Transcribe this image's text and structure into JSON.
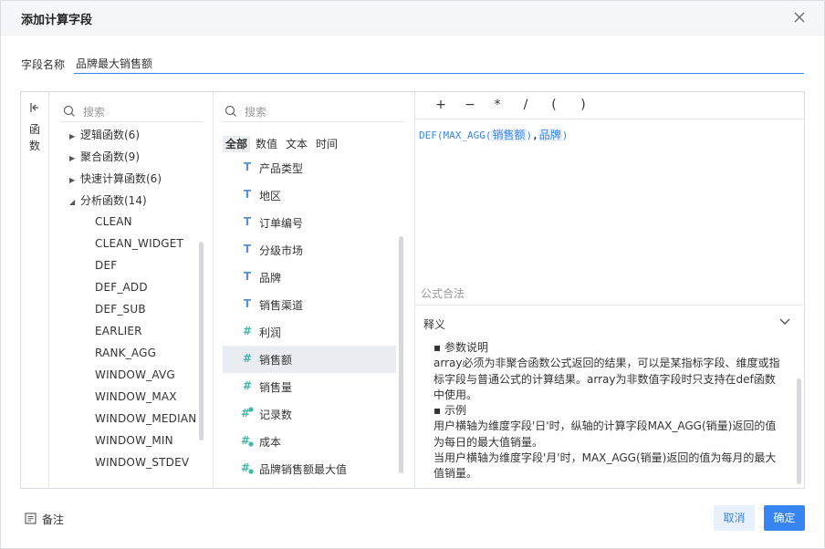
{
  "dialog": {
    "title": "添加计算字段",
    "field_name_label": "字段名称",
    "field_name_value": "品牌最大销售额"
  },
  "side_tab": {
    "label": "函数"
  },
  "functions": {
    "search_placeholder": "搜索",
    "groups": [
      {
        "label": "逻辑函数(6)",
        "expanded": false
      },
      {
        "label": "聚合函数(9)",
        "expanded": false
      },
      {
        "label": "快速计算函数(6)",
        "expanded": false
      },
      {
        "label": "分析函数(14)",
        "expanded": true
      }
    ],
    "items": [
      "CLEAN",
      "CLEAN_WIDGET",
      "DEF",
      "DEF_ADD",
      "DEF_SUB",
      "EARLIER",
      "RANK_AGG",
      "WINDOW_AVG",
      "WINDOW_MAX",
      "WINDOW_MEDIAN",
      "WINDOW_MIN",
      "WINDOW_STDEV"
    ]
  },
  "fields": {
    "search_placeholder": "搜索",
    "tabs": [
      "全部",
      "数值",
      "文本",
      "时间"
    ],
    "active_tab": "全部",
    "items": [
      {
        "name": "产品类型",
        "type": "text-icon"
      },
      {
        "name": "地区",
        "type": "text-icon"
      },
      {
        "name": "订单编号",
        "type": "text-icon"
      },
      {
        "name": "分级市场",
        "type": "text-icon"
      },
      {
        "name": "品牌",
        "type": "text-icon"
      },
      {
        "name": "销售渠道",
        "type": "text-icon"
      },
      {
        "name": "利润",
        "type": "number-icon"
      },
      {
        "name": "销售额",
        "type": "number-icon",
        "selected": true
      },
      {
        "name": "销售量",
        "type": "number-icon"
      },
      {
        "name": "记录数",
        "type": "calculated-number-icon"
      },
      {
        "name": "成本",
        "type": "calculated-number-icon"
      },
      {
        "name": "品牌销售额最大值",
        "type": "calculated-number-icon"
      }
    ]
  },
  "editor": {
    "operators": [
      "+",
      "−",
      "*",
      "/",
      "(",
      ")"
    ],
    "formula": {
      "prefix": "DEF(MAX_AGG(",
      "token1": "销售额",
      "middle": ")",
      "comma": ",",
      "token2": "品牌",
      "suffix": ")"
    },
    "status": "公式合法"
  },
  "description": {
    "title": "释义",
    "lines": [
      "▪ 参数说明",
      "array必须为非聚合函数公式返回的结果，可以是某指标字段、维度或指",
      "标字段与普通公式的计算结果。array为非数值字段时只支持在def函数",
      "中使用。",
      "▪ 示例",
      "用户横轴为维度字段'日'时，纵轴的计算字段MAX_AGG(销量)返回的值",
      "为每日的最大值销量。",
      "当用户横轴为维度字段'月'时，MAX_AGG(销量)返回的值为每月的最大",
      "值销量。"
    ]
  },
  "footer": {
    "note_label": "备注",
    "cancel_label": "取消",
    "ok_label": "确定"
  },
  "colors": {
    "accent": "#3685f2",
    "header_bg": "#f4f6f9",
    "selected_bg": "#e9ecf1"
  }
}
